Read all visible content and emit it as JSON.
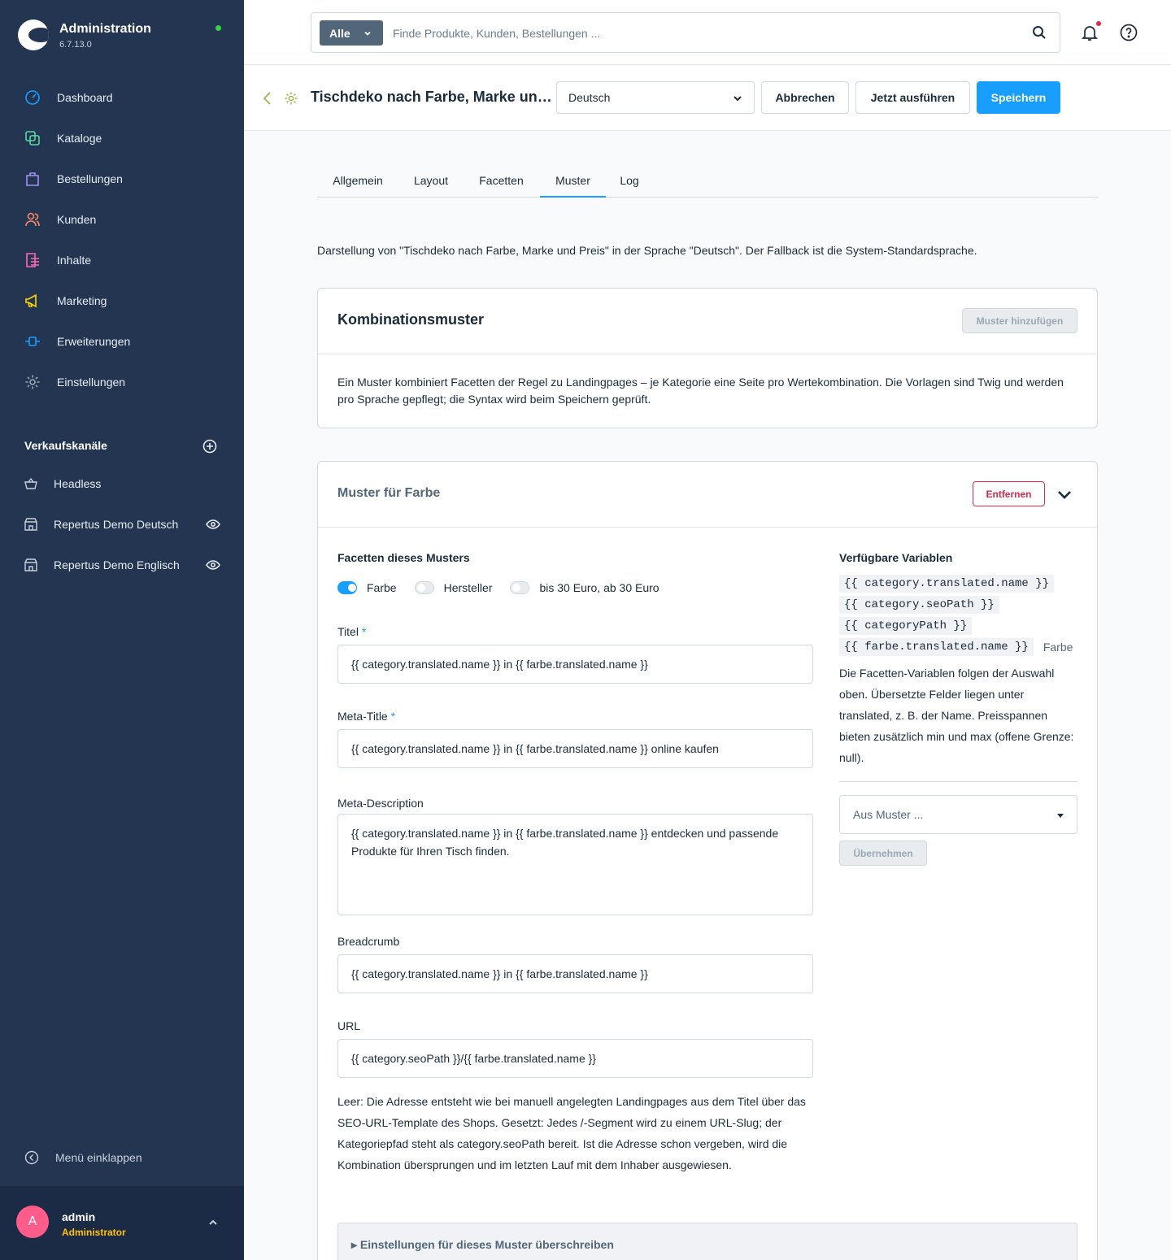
{
  "sidebar": {
    "app_title": "Administration",
    "version": "6.7.13.0",
    "nav": [
      {
        "label": "Dashboard",
        "icon": "dashboard-icon",
        "color": "#189eff"
      },
      {
        "label": "Kataloge",
        "icon": "catalog-icon",
        "color": "#57d9a3"
      },
      {
        "label": "Bestellungen",
        "icon": "orders-icon",
        "color": "#a092f0"
      },
      {
        "label": "Kunden",
        "icon": "customers-icon",
        "color": "#f88962"
      },
      {
        "label": "Inhalte",
        "icon": "content-icon",
        "color": "#ff68b4"
      },
      {
        "label": "Marketing",
        "icon": "marketing-icon",
        "color": "#ffd700"
      },
      {
        "label": "Erweiterungen",
        "icon": "extensions-icon",
        "color": "#189eff"
      },
      {
        "label": "Einstellungen",
        "icon": "settings-icon",
        "color": "#9aa8b5"
      }
    ],
    "sales_channels_title": "Verkaufskanäle",
    "sales_channels": [
      {
        "label": "Headless"
      },
      {
        "label": "Repertus Demo Deutsch"
      },
      {
        "label": "Repertus Demo Englisch"
      }
    ],
    "collapse_label": "Menü einklappen",
    "user": {
      "initial": "A",
      "name": "admin",
      "role": "Administrator"
    }
  },
  "topbar": {
    "search_type": "Alle",
    "search_placeholder": "Finde Produkte, Kunden, Bestellungen ..."
  },
  "smartbar": {
    "title": "Tischdeko nach Farbe, Marke und Preis",
    "language": "Deutsch",
    "cancel": "Abbrechen",
    "run_now": "Jetzt ausführen",
    "save": "Speichern"
  },
  "tabs": [
    {
      "label": "Allgemein"
    },
    {
      "label": "Layout"
    },
    {
      "label": "Facetten"
    },
    {
      "label": "Muster",
      "active": true
    },
    {
      "label": "Log"
    }
  ],
  "description": "Darstellung von \"Tischdeko nach Farbe, Marke und Preis\" in der Sprache \"Deutsch\". Der Fallback ist die System-Standardsprache.",
  "combination_card": {
    "title": "Kombinationsmuster",
    "add_button": "Muster hinzufügen",
    "text": "Ein Muster kombiniert Facetten der Regel zu Landingpages – je Kategorie eine Seite pro Wertekombination. Die Vorlagen sind Twig und werden pro Sprache gepflegt; die Syntax wird beim Speichern geprüft."
  },
  "pattern_card": {
    "title": "Muster für Farbe",
    "remove_button": "Entfernen",
    "facets_label": "Facetten dieses Musters",
    "facets": [
      {
        "label": "Farbe",
        "on": true
      },
      {
        "label": "Hersteller",
        "on": false
      },
      {
        "label": "bis 30 Euro, ab 30 Euro",
        "on": false
      }
    ],
    "title_label": "Titel",
    "title_value": "{{ category.translated.name }} in {{ farbe.translated.name }}",
    "meta_title_label": "Meta-Title",
    "meta_title_value": "{{ category.translated.name }} in {{ farbe.translated.name }} online kaufen",
    "meta_description_label": "Meta-Description",
    "meta_description_value": "{{ category.translated.name }} in {{ farbe.translated.name }} entdecken und passende Produkte für Ihren Tisch finden.",
    "breadcrumb_label": "Breadcrumb",
    "breadcrumb_value": "{{ category.translated.name }} in {{ farbe.translated.name }}",
    "url_label": "URL",
    "url_value": "{{ category.seoPath }}/{{ farbe.translated.name }}",
    "url_help": "Leer: Die Adresse entsteht wie bei manuell angelegten Landingpages aus dem Titel über das SEO-URL-Template des Shops. Gesetzt: Jedes /-Segment wird zu einem URL-Slug; der Kategoriepfad steht als category.seoPath bereit. Ist die Adresse schon vergeben, wird die Kombination übersprungen und im letzten Lauf mit dem Inhaber ausgewiesen.",
    "variables_title": "Verfügbare Variablen",
    "variables": [
      {
        "code": "{{ category.translated.name }}",
        "hint": ""
      },
      {
        "code": "{{ category.seoPath }}",
        "hint": ""
      },
      {
        "code": "{{ categoryPath }}",
        "hint": ""
      },
      {
        "code": "{{ farbe.translated.name }}",
        "hint": "Farbe"
      }
    ],
    "variables_note": "Die Facetten-Variablen folgen der Auswahl oben. Übersetzte Felder liegen unter translated, z. B. der Name. Preisspannen bieten zusätzlich min und max (offene Grenze: null).",
    "from_pattern_placeholder": "Aus Muster ...",
    "apply_button": "Übernehmen",
    "override_label": "Einstellungen für dieses Muster überschreiben"
  }
}
